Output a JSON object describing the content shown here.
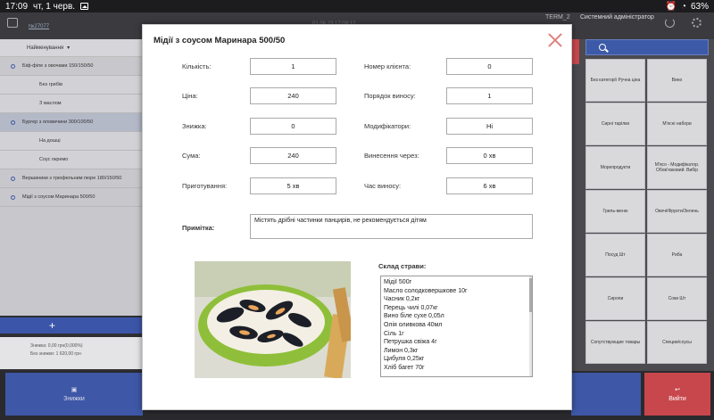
{
  "status_bar": {
    "time": "17:09",
    "date": "чт, 1 черв.",
    "battery": "63%"
  },
  "header": {
    "order_number": "№27077",
    "datetime": "01.06.23 17:09:12",
    "terminal": "TERM_2",
    "user": "Системний адміністратор"
  },
  "order_list": {
    "header": "Найменування",
    "items": [
      {
        "label": "Біф-філе з овочами 150/150/50",
        "level": 0,
        "selected": false
      },
      {
        "label": "Без грибів",
        "level": 1,
        "selected": false
      },
      {
        "label": "З маслом",
        "level": 1,
        "selected": false
      },
      {
        "label": "Бургер з яловичини 300/100/50",
        "level": 0,
        "selected": true
      },
      {
        "label": "На дошці",
        "level": 1,
        "selected": false
      },
      {
        "label": "Соус окремо",
        "level": 1,
        "selected": false
      },
      {
        "label": "Вершиники з трюфельним пюре 180/150/50",
        "level": 0,
        "selected": false
      },
      {
        "label": "Мідії з соусом Маринара 500/50",
        "level": 0,
        "selected": false
      }
    ],
    "footer_discount": "Знижка: 0,00 грн(0,000%)",
    "footer_total": "Без знижки: 1 620,00 грн"
  },
  "bottom_bar": {
    "discount_label": "Знижки",
    "exit_label": "Вийти"
  },
  "categories": [
    "Без категорії Ручна ціна",
    "Вино",
    "Сирні тарілки",
    "М'ясні набори",
    "Морепродукти",
    "М'ясо - Модифікатор. Обов'язковий. Вибір",
    "Гриль-меню",
    "Овочі/Фрукти/Зелень",
    "Посуд Шт",
    "Риба",
    "Сиропи",
    "Соки Шт",
    "Сопутствующие товары",
    "Специи/соусы"
  ],
  "modal": {
    "title": "Мідії з соусом Маринара 500/50",
    "fields_left": [
      {
        "label": "Кількість:",
        "value": "1"
      },
      {
        "label": "Ціна:",
        "value": "240"
      },
      {
        "label": "Знижка:",
        "value": "0"
      },
      {
        "label": "Сума:",
        "value": "240"
      },
      {
        "label": "Приготування:",
        "value": "5 хв"
      }
    ],
    "fields_right": [
      {
        "label": "Номер клієнта:",
        "value": "0"
      },
      {
        "label": "Порядок виносу:",
        "value": "1"
      },
      {
        "label": "Модифікатори:",
        "value": "Ні"
      },
      {
        "label": "Винесення через:",
        "value": "0 хв"
      },
      {
        "label": "Час виносу:",
        "value": "6 хв"
      }
    ],
    "note_label": "Примітка:",
    "note_value": "Містять дрібні частинки панцирів, не рекомендується  дітям",
    "composition_label": "Склад страви:",
    "composition": [
      "Мідії 500г",
      "Масло солодковершкове 10г",
      "Часник 0,2кг",
      "Перець чилі 0,07кг",
      "Вино біле сухе 0,05л",
      "Олія оливкова 40мл",
      "Сіль 1г",
      "Петрушка свіжа 4г",
      "Лимон 0,3кг",
      "Цибуля 0,25кг",
      "Хліб багет 70г"
    ]
  }
}
